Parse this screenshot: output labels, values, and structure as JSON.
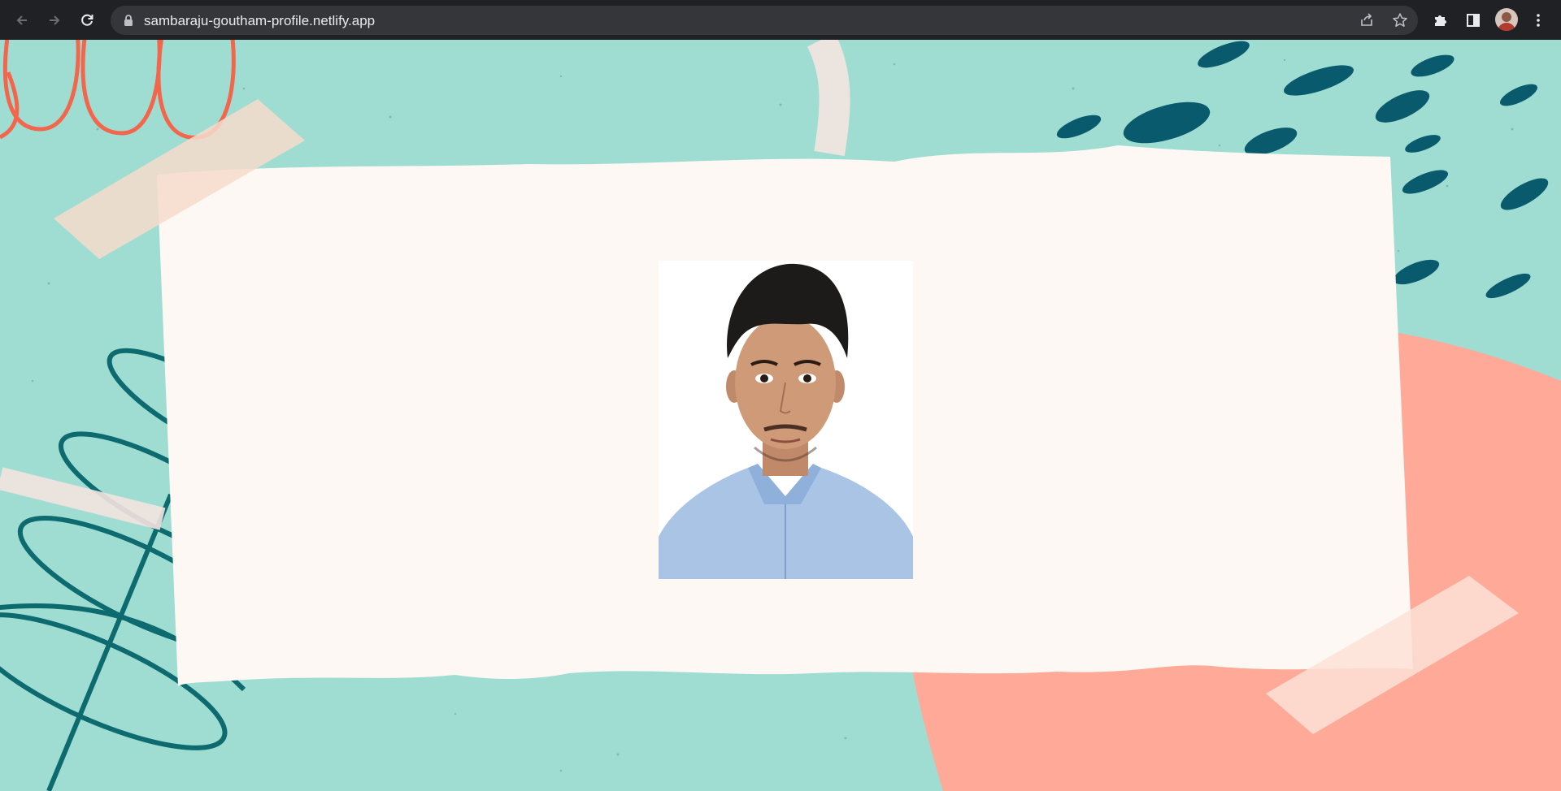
{
  "browser": {
    "url": "sambaraju-goutham-profile.netlify.app",
    "icons": {
      "back": "arrow-left-icon",
      "forward": "arrow-right-icon",
      "reload": "reload-icon",
      "lock": "lock-icon",
      "share": "share-icon",
      "bookmark": "star-icon",
      "extensions": "puzzle-icon",
      "side_panel": "side-panel-icon",
      "profile": "avatar",
      "menu": "kebab-menu-icon"
    }
  },
  "page": {
    "colors": {
      "background": "#9fddd3",
      "paper": "#fdf8f3",
      "coral": "#ffaa98",
      "navy": "#0a5a6e",
      "tape": "#f6dccb",
      "squiggle_red": "#f4664b",
      "scribble_teal": "#0d6b70"
    },
    "profile_photo": {
      "subject": "portrait photo of a young man in a light blue shirt"
    }
  }
}
